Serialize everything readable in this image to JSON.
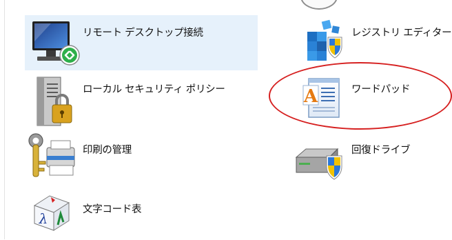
{
  "items": [
    {
      "label": "リモート デスクトップ接続",
      "icon": "remote-desktop-icon",
      "selected": true
    },
    {
      "label": "レジストリ エディター",
      "icon": "registry-editor-icon"
    },
    {
      "label": "ローカル セキュリティ ポリシー",
      "icon": "local-security-policy-icon"
    },
    {
      "label": "ワードパッド",
      "icon": "wordpad-icon",
      "highlighted": true
    },
    {
      "label": "印刷の管理",
      "icon": "print-management-icon"
    },
    {
      "label": "回復ドライブ",
      "icon": "recovery-drive-icon"
    },
    {
      "label": "文字コード表",
      "icon": "character-map-icon"
    }
  ],
  "colors": {
    "selection": "#e6f1fb",
    "highlight_ring": "#d62020"
  }
}
